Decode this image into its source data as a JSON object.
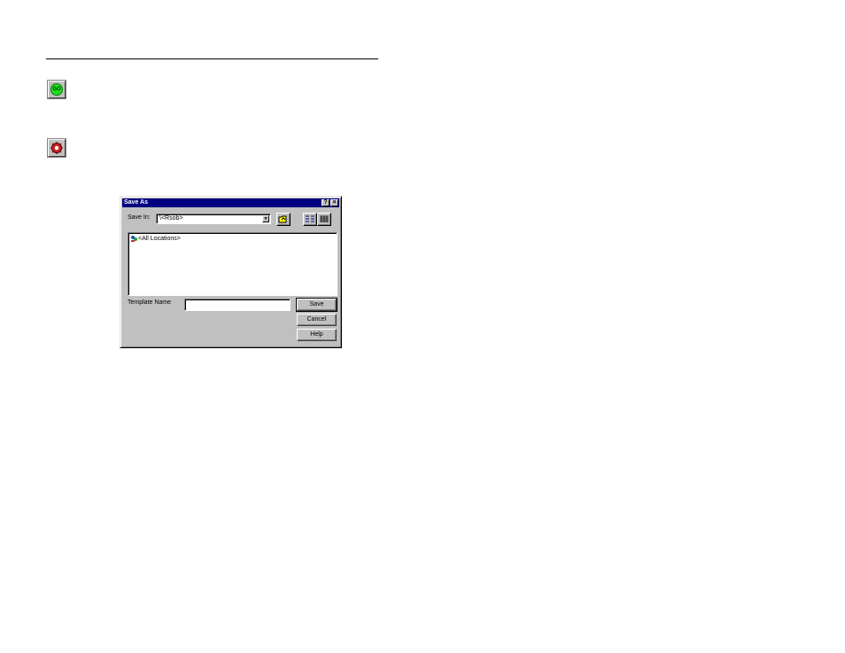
{
  "toolbar_icons": {
    "go_icon_text": "GO",
    "go_icon": "go-icon",
    "stop_icon": "stop-icon"
  },
  "dialog": {
    "title": "Save As",
    "title_help_glyph": "?",
    "title_close_glyph": "×",
    "save_in_label": "Save In:",
    "save_in_value": "\\<Rsob>",
    "file_list": [
      {
        "label": "<All Locations>",
        "icon": "locations-icon"
      }
    ],
    "template_name_label": "Template Name",
    "template_name_value": "",
    "buttons": {
      "save": "Save",
      "cancel": "Cancel",
      "help": "Help"
    }
  },
  "colors": {
    "titlebar": "#000080",
    "dialog_face": "#c0c0c0",
    "go_green": "#22dd22",
    "stop_red": "#cc2222"
  }
}
